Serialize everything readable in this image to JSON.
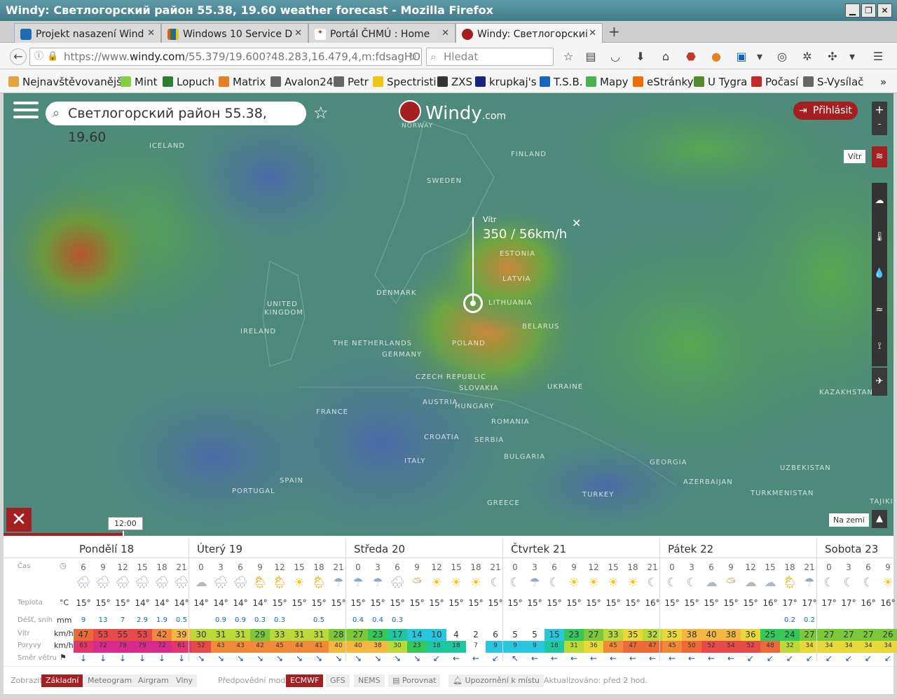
{
  "window": {
    "title": "Windy: Светлогорский район 55.38, 19.60 weather forecast - Mozilla Firefox"
  },
  "tabs": [
    {
      "label": "Projekt nasazení Wind",
      "color": "#1e6bb8"
    },
    {
      "label": "Windows 10 Service D",
      "color": "#e05a28"
    },
    {
      "label": "Portál ČHMÚ : Home",
      "color": "#c0392b"
    },
    {
      "label": "Windy: Светлогорскиі",
      "color": "#a51e22"
    }
  ],
  "nav": {
    "url_prefix": "https://www.",
    "url_domain": "windy.com",
    "url_rest": "/55.379/19.600?48.283,16.479,4,m:fdsagHO",
    "search_placeholder": "Hledat"
  },
  "bookmarks": [
    {
      "label": "Nejnavštěvovanější",
      "color": "#e6a23c"
    },
    {
      "label": "Mint",
      "color": "#87cf3e"
    },
    {
      "label": "Lopuch",
      "color": "#2e7d32"
    },
    {
      "label": "Matrix",
      "color": "#e67e22"
    },
    {
      "label": "Avalon24",
      "color": "#666"
    },
    {
      "label": "Petr",
      "color": "#666"
    },
    {
      "label": "Spectristi",
      "color": "#f1c40f"
    },
    {
      "label": "ZXS",
      "color": "#333"
    },
    {
      "label": "krupkaj's",
      "color": "#1a237e"
    },
    {
      "label": "T.S.B.",
      "color": "#1565c0"
    },
    {
      "label": "Mapy",
      "color": "#4caf50"
    },
    {
      "label": "eStránky",
      "color": "#ef6c00"
    },
    {
      "label": "U Tygra",
      "color": "#558b2f"
    },
    {
      "label": "Počasí",
      "color": "#c62828"
    },
    {
      "label": "S-Vysílač",
      "color": "#666"
    }
  ],
  "map": {
    "search_text": "Светлогорский район 55.38, 19.60",
    "logo": "Windy",
    "logo_suffix": ".com",
    "logo_sub": "NORWAY",
    "login": "Přihlásit",
    "layer_label": "Vítr",
    "ground_label": "Na zemi",
    "time_label": "12:00",
    "popup_title": "Vítr",
    "popup_value": "350 / 56km/h",
    "zoom_in": "+",
    "zoom_out": "-",
    "places": [
      {
        "name": "ICELAND"
      },
      {
        "name": "FINLAND"
      },
      {
        "name": "SWEDEN"
      },
      {
        "name": "ESTONIA"
      },
      {
        "name": "LATVIA"
      },
      {
        "name": "DENMARK"
      },
      {
        "name": "LITHUANIA"
      },
      {
        "name": "UNITED"
      },
      {
        "name": "KINGDOM"
      },
      {
        "name": "IRELAND"
      },
      {
        "name": "BELARUS"
      },
      {
        "name": "THE NETHERLANDS"
      },
      {
        "name": "POLAND"
      },
      {
        "name": "GERMANY"
      },
      {
        "name": "CZECH REPUBLIC"
      },
      {
        "name": "SLOVAKIA"
      },
      {
        "name": "UKRAINE"
      },
      {
        "name": "AUSTRIA"
      },
      {
        "name": "HUNGARY"
      },
      {
        "name": "FRANCE"
      },
      {
        "name": "ROMANIA"
      },
      {
        "name": "CROATIA"
      },
      {
        "name": "SERBIA"
      },
      {
        "name": "BULGARIA"
      },
      {
        "name": "ITALY"
      },
      {
        "name": "SPAIN"
      },
      {
        "name": "PORTUGAL"
      },
      {
        "name": "GREECE"
      },
      {
        "name": "TURKEY"
      },
      {
        "name": "GEORGIA"
      },
      {
        "name": "AZERBAIJAN"
      },
      {
        "name": "TURKMENISTAN"
      },
      {
        "name": "UZBEKISTAN"
      },
      {
        "name": "KAZAKHSTAN"
      },
      {
        "name": "TAJIKISTAN"
      }
    ]
  },
  "forecast": {
    "days": [
      "Pondělí 18",
      "Úterý 19",
      "Středa 20",
      "Čtvrtek 21",
      "Pátek 22",
      "Sobota 23"
    ],
    "row_labels": {
      "time": "Čas",
      "temp": "Teplota",
      "temp_unit": "°C",
      "rain": "Déšť, sníh",
      "rain_unit": "mm",
      "wind": "Vítr",
      "wind_unit": "km/h",
      "gust": "Poryvy",
      "gust_unit": "km/h",
      "dir": "Směr větru"
    },
    "hours": [
      "6",
      "9",
      "12",
      "15",
      "18",
      "21",
      "0",
      "3",
      "6",
      "9",
      "12",
      "15",
      "18",
      "21",
      "0",
      "3",
      "6",
      "9",
      "12",
      "15",
      "18",
      "21",
      "0",
      "3",
      "6",
      "9",
      "12",
      "15",
      "18",
      "21",
      "0",
      "3",
      "6",
      "9",
      "12",
      "15",
      "18",
      "21",
      "0",
      "3",
      "6",
      "9"
    ],
    "weather": [
      "rain",
      "rain",
      "rain",
      "rain",
      "rain",
      "rain",
      "cloud",
      "rain",
      "rain",
      "sunrain",
      "sunrain",
      "sun",
      "sunrain",
      "moonrain",
      "moonrain",
      "moonrain",
      "rain",
      "cloudsun",
      "sun",
      "sun",
      "sun",
      "moon",
      "moon",
      "moonrain",
      "moon",
      "sun",
      "sun",
      "sun",
      "sun",
      "moon",
      "moon",
      "moon",
      "cloud",
      "cloudsun",
      "cloud",
      "cloud",
      "sunrain",
      "moonrain",
      "moon",
      "moon",
      "moon",
      "sun"
    ],
    "temps": [
      "15°",
      "15°",
      "15°",
      "14°",
      "14°",
      "14°",
      "14°",
      "14°",
      "14°",
      "14°",
      "15°",
      "15°",
      "15°",
      "15°",
      "15°",
      "15°",
      "15°",
      "15°",
      "15°",
      "15°",
      "15°",
      "15°",
      "15°",
      "15°",
      "15°",
      "15°",
      "15°",
      "15°",
      "15°",
      "16°",
      "15°",
      "15°",
      "15°",
      "15°",
      "15°",
      "16°",
      "17°",
      "17°",
      "17°",
      "17°",
      "16°",
      "16°"
    ],
    "rain": [
      "9",
      "13",
      "7",
      "2.9",
      "1.9",
      "0.5",
      "",
      "0.9",
      "0.9",
      "0.3",
      "0.3",
      "",
      "0.5",
      "",
      "0.4",
      "0.4",
      "0.3",
      "",
      "",
      "",
      "",
      "",
      "",
      "",
      "",
      "",
      "",
      "",
      "",
      "",
      "",
      "",
      "",
      "",
      "",
      "",
      "0.2",
      "0.2",
      "",
      "",
      "",
      ""
    ],
    "wind": [
      47,
      53,
      55,
      53,
      42,
      39,
      30,
      31,
      31,
      29,
      33,
      31,
      31,
      28,
      27,
      23,
      17,
      14,
      10,
      4,
      2,
      6,
      5,
      5,
      15,
      23,
      27,
      33,
      35,
      32,
      35,
      38,
      40,
      38,
      36,
      25,
      24,
      27,
      27,
      27,
      27,
      26
    ],
    "gust": [
      63,
      72,
      79,
      79,
      72,
      61,
      52,
      43,
      43,
      42,
      45,
      44,
      41,
      40,
      40,
      38,
      30,
      23,
      18,
      18,
      7,
      9,
      9,
      9,
      18,
      31,
      36,
      45,
      47,
      47,
      45,
      50,
      52,
      54,
      52,
      48,
      32,
      34,
      34,
      34,
      34,
      34
    ],
    "dir": [
      "↓",
      "↓",
      "↓",
      "↓",
      "↓",
      "↓",
      "↘",
      "↘",
      "↘",
      "↘",
      "↘",
      "↘",
      "↘",
      "↘",
      "↘",
      "↘",
      "↘",
      "↘",
      "↙",
      "←",
      "←",
      "↙",
      "↖",
      "←",
      "←",
      "←",
      "←",
      "←",
      "←",
      "←",
      "←",
      "←",
      "←",
      "←",
      "↙",
      "↙",
      "↙",
      "↙",
      "↙",
      "↙",
      "↙",
      "↙"
    ]
  },
  "bottom": {
    "show": "Zobrazit",
    "btn_basic": "Základní",
    "btn_meteo": "Meteogram",
    "btn_air": "Airgram",
    "btn_waves": "Vlny",
    "model_label": "Předpovědní model",
    "m_ecmwf": "ECMWF",
    "m_gfs": "GFS",
    "m_nems": "NEMS",
    "compare": "Porovnat",
    "alert": "Upozornění k místu",
    "updated": "Aktualizováno: před 2 hod."
  }
}
